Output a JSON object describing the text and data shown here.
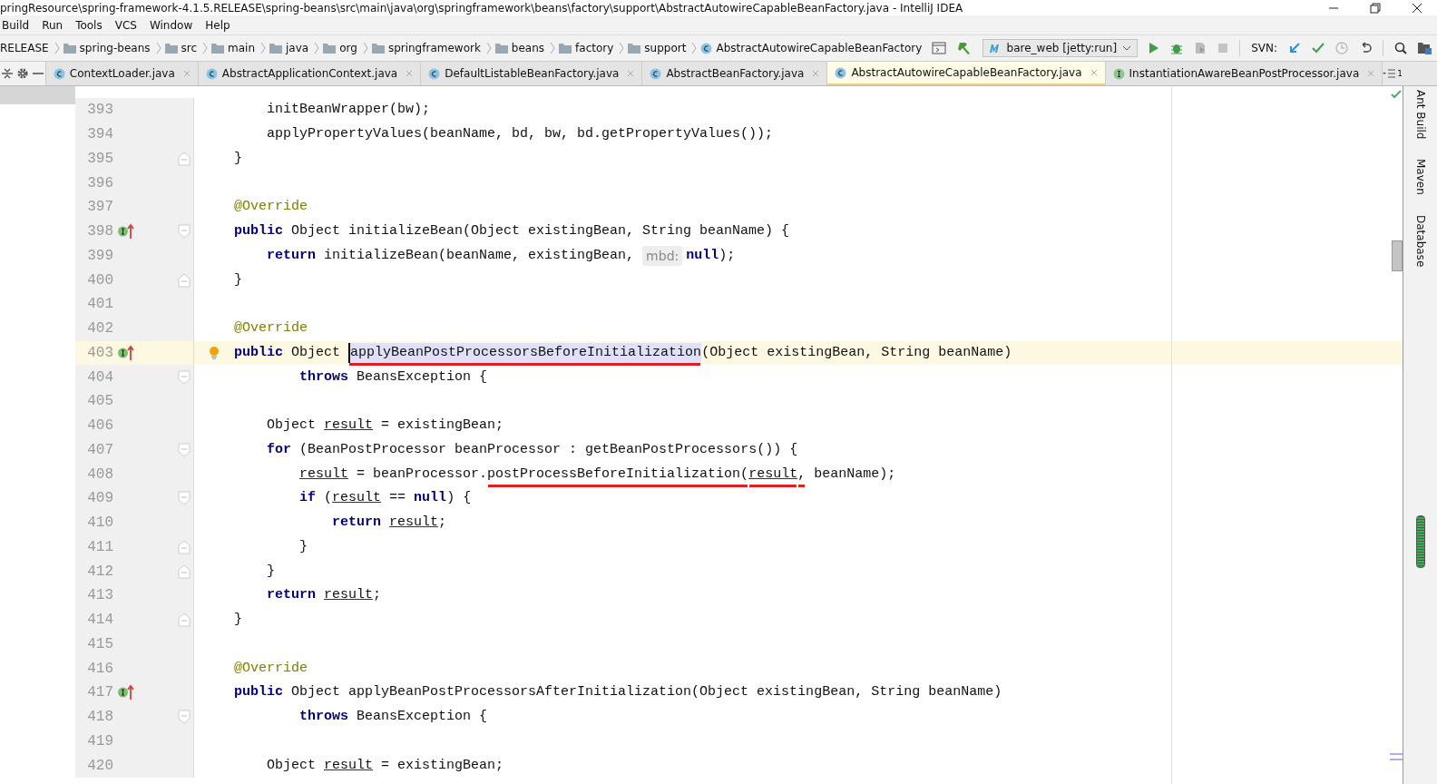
{
  "window": {
    "title": "pringResource\\spring-framework-4.1.5.RELEASE\\spring-beans\\src\\main\\java\\org\\springframework\\beans\\factory\\support\\AbstractAutowireCapableBeanFactory.java - IntelliJ IDEA"
  },
  "menu": [
    "Build",
    "Run",
    "Tools",
    "VCS",
    "Window",
    "Help"
  ],
  "breadcrumbs": [
    {
      "label": "RELEASE",
      "kind": "none"
    },
    {
      "label": "spring-beans",
      "kind": "folder"
    },
    {
      "label": "src",
      "kind": "folder"
    },
    {
      "label": "main",
      "kind": "folder"
    },
    {
      "label": "java",
      "kind": "folder"
    },
    {
      "label": "org",
      "kind": "folder"
    },
    {
      "label": "springframework",
      "kind": "folder"
    },
    {
      "label": "beans",
      "kind": "folder"
    },
    {
      "label": "factory",
      "kind": "folder"
    },
    {
      "label": "support",
      "kind": "folder"
    },
    {
      "label": "AbstractAutowireCapableBeanFactory",
      "kind": "class"
    }
  ],
  "run_config": "bare_web [jetty:run]",
  "svn_label": "SVN:",
  "tabs": [
    {
      "label": "ContextLoader.java",
      "kind": "class",
      "selected": false
    },
    {
      "label": "AbstractApplicationContext.java",
      "kind": "class",
      "selected": false
    },
    {
      "label": "DefaultListableBeanFactory.java",
      "kind": "class",
      "selected": false
    },
    {
      "label": "AbstractBeanFactory.java",
      "kind": "class",
      "selected": false
    },
    {
      "label": "AbstractAutowireCapableBeanFactory.java",
      "kind": "class",
      "selected": true
    },
    {
      "label": "InstantiationAwareBeanPostProcessor.java",
      "kind": "interface",
      "selected": false
    }
  ],
  "tab_overflow_count": "1",
  "side_tools": [
    "Ant Build",
    "Maven",
    "Database"
  ],
  "lines": [
    {
      "number": "393",
      "tokens": [
        {
          "text": "    initBeanWrapper(bw);",
          "kind": "plain"
        }
      ]
    },
    {
      "number": "394",
      "tokens": [
        {
          "text": "    applyPropertyValues(beanName, bd, bw, bd.getPropertyValues());",
          "kind": "plain"
        }
      ]
    },
    {
      "number": "395",
      "fold_end": true,
      "tokens": [
        {
          "text": "}",
          "kind": "plain"
        }
      ]
    },
    {
      "number": "396"
    },
    {
      "number": "397",
      "tokens": [
        {
          "text": "@Override",
          "kind": "annotation"
        }
      ]
    },
    {
      "number": "398",
      "override": true,
      "fold_start": true,
      "tokens": [
        {
          "text": "public",
          "kind": "keyword"
        },
        {
          "text": " Object initializeBean(Object existingBean, String beanName) {",
          "kind": "plain"
        }
      ]
    },
    {
      "number": "399",
      "tokens": [
        {
          "text": "    return",
          "kind": "keyword"
        },
        {
          "text": " initializeBean(beanName, existingBean, ",
          "kind": "plain"
        },
        {
          "text": "mbd:",
          "kind": "hint"
        },
        {
          "text": "null",
          "kind": "keyword"
        },
        {
          "text": ");",
          "kind": "plain"
        }
      ]
    },
    {
      "number": "400",
      "fold_end": true,
      "tokens": [
        {
          "text": "}",
          "kind": "plain"
        }
      ]
    },
    {
      "number": "401"
    },
    {
      "number": "402",
      "tokens": [
        {
          "text": "@Override",
          "kind": "annotation"
        }
      ]
    },
    {
      "number": "403",
      "current": true,
      "override": true,
      "bulb": true,
      "tokens": [
        {
          "text": "public",
          "kind": "keyword"
        },
        {
          "text": " Object ",
          "kind": "plain"
        },
        {
          "text": "applyBeanPostProcessorsBeforeInitialization",
          "kind": "plain",
          "selected": true,
          "caret": true,
          "red_underline": true
        },
        {
          "text": "(Object existingBean, String beanName)",
          "kind": "plain"
        }
      ]
    },
    {
      "number": "404",
      "fold_start": true,
      "tokens": [
        {
          "text": "        throws",
          "kind": "keyword"
        },
        {
          "text": " BeansException {",
          "kind": "plain"
        }
      ]
    },
    {
      "number": "405"
    },
    {
      "number": "406",
      "tokens": [
        {
          "text": "    Object ",
          "kind": "plain"
        },
        {
          "text": "result",
          "kind": "variable"
        },
        {
          "text": " = existingBean;",
          "kind": "plain"
        }
      ]
    },
    {
      "number": "407",
      "fold_start": true,
      "tokens": [
        {
          "text": "    for",
          "kind": "keyword"
        },
        {
          "text": " (BeanPostProcessor beanProcessor : getBeanPostProcessors()) {",
          "kind": "plain"
        }
      ]
    },
    {
      "number": "408",
      "tokens": [
        {
          "text": "        result",
          "kind": "variable"
        },
        {
          "text": " = beanProcessor.",
          "kind": "plain"
        },
        {
          "text": "postProcessBeforeInitialization(",
          "kind": "plain",
          "red_underline": true
        },
        {
          "text": "result",
          "kind": "variable",
          "red_underline": true
        },
        {
          "text": ",",
          "kind": "plain",
          "red_underline": true
        },
        {
          "text": " beanName);",
          "kind": "plain"
        }
      ]
    },
    {
      "number": "409",
      "fold_start": true,
      "tokens": [
        {
          "text": "        if",
          "kind": "keyword"
        },
        {
          "text": " (",
          "kind": "plain"
        },
        {
          "text": "result",
          "kind": "variable"
        },
        {
          "text": " == ",
          "kind": "plain"
        },
        {
          "text": "null",
          "kind": "keyword"
        },
        {
          "text": ") {",
          "kind": "plain"
        }
      ]
    },
    {
      "number": "410",
      "tokens": [
        {
          "text": "            return ",
          "kind": "keyword"
        },
        {
          "text": "result",
          "kind": "variable"
        },
        {
          "text": ";",
          "kind": "plain"
        }
      ]
    },
    {
      "number": "411",
      "fold_end": true,
      "tokens": [
        {
          "text": "        }",
          "kind": "plain"
        }
      ]
    },
    {
      "number": "412",
      "fold_end": true,
      "tokens": [
        {
          "text": "    }",
          "kind": "plain"
        }
      ]
    },
    {
      "number": "413",
      "tokens": [
        {
          "text": "    return ",
          "kind": "keyword"
        },
        {
          "text": "result",
          "kind": "variable"
        },
        {
          "text": ";",
          "kind": "plain"
        }
      ]
    },
    {
      "number": "414",
      "fold_end": true,
      "tokens": [
        {
          "text": "}",
          "kind": "plain"
        }
      ]
    },
    {
      "number": "415"
    },
    {
      "number": "416",
      "tokens": [
        {
          "text": "@Override",
          "kind": "annotation"
        }
      ]
    },
    {
      "number": "417",
      "override": true,
      "tokens": [
        {
          "text": "public",
          "kind": "keyword"
        },
        {
          "text": " Object applyBeanPostProcessorsAfterInitialization(Object existingBean, String beanName)",
          "kind": "plain"
        }
      ]
    },
    {
      "number": "418",
      "fold_start": true,
      "tokens": [
        {
          "text": "        throws",
          "kind": "keyword"
        },
        {
          "text": " BeansException {",
          "kind": "plain"
        }
      ]
    },
    {
      "number": "419"
    },
    {
      "number": "420",
      "tokens": [
        {
          "text": "    Object ",
          "kind": "plain"
        },
        {
          "text": "result",
          "kind": "variable"
        },
        {
          "text": " = existingBean;",
          "kind": "plain"
        }
      ]
    }
  ]
}
